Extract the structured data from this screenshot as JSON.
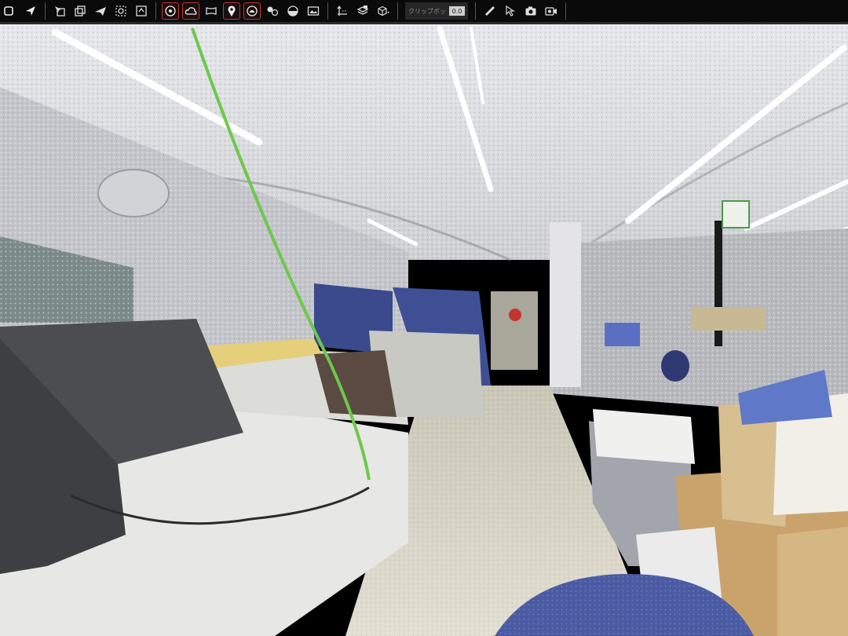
{
  "toolbar": {
    "clip_box_label": "クリップボッ",
    "clip_box_value": "0.0",
    "tools": [
      {
        "name": "navigate-icon",
        "active": false
      },
      {
        "name": "pointer-arrow-icon",
        "active": false
      },
      {
        "name": "select-copy-icon",
        "active": false
      },
      {
        "name": "layers-icon",
        "active": false
      },
      {
        "name": "flight-icon",
        "active": false
      },
      {
        "name": "zoom-fit-icon",
        "active": false
      },
      {
        "name": "home-view-icon",
        "active": false
      },
      {
        "name": "point-target-icon",
        "active": true
      },
      {
        "name": "cloud-icon",
        "active": true
      },
      {
        "name": "panorama-icon",
        "active": false
      },
      {
        "name": "location-pin-icon",
        "active": true
      },
      {
        "name": "scan-cloud-icon",
        "active": true
      },
      {
        "name": "spheres-icon",
        "active": false
      },
      {
        "name": "half-sphere-icon",
        "active": false
      },
      {
        "name": "image-icon",
        "active": false
      },
      {
        "name": "axis-icon",
        "active": false
      },
      {
        "name": "layers-stack-icon",
        "active": false
      },
      {
        "name": "box-dropdown-icon",
        "active": false
      },
      {
        "name": "measure-ruler-icon",
        "active": false
      },
      {
        "name": "cursor-edit-icon",
        "active": false
      },
      {
        "name": "camera-icon",
        "active": false
      },
      {
        "name": "video-camera-icon",
        "active": false
      }
    ]
  },
  "scene": {
    "description_visible": false,
    "colors": {
      "ceiling": "#d9dadc",
      "wall": "#c8c9cc",
      "floor": "#d8d4c4",
      "partition_blue": "#3a4a8c",
      "cable_green": "#6ec84a",
      "accent_red": "#c4332d"
    }
  }
}
